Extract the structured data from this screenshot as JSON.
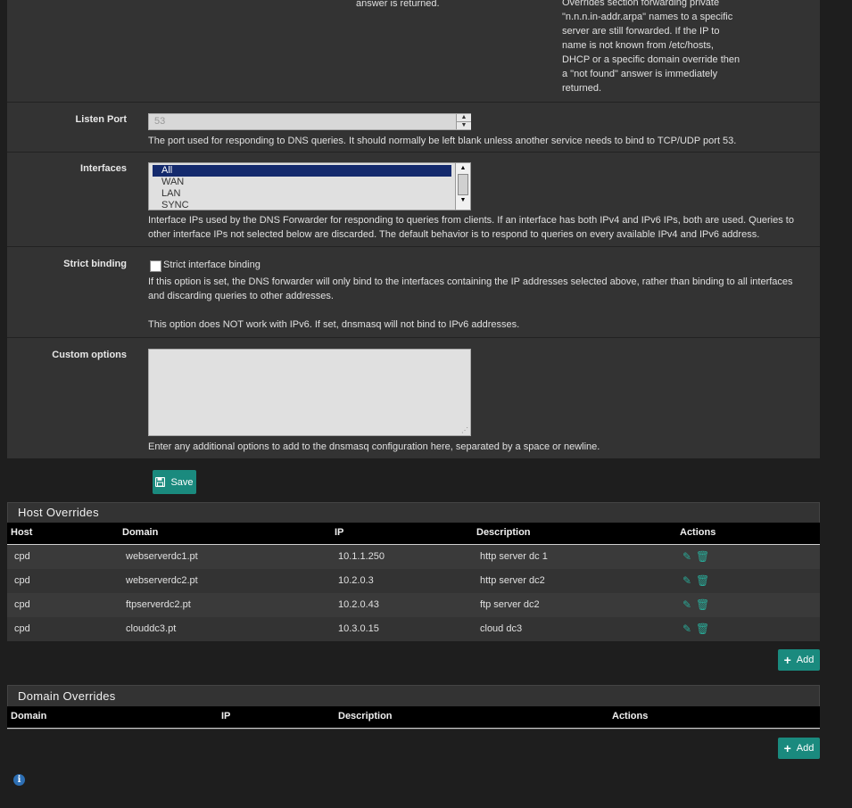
{
  "top_section": {
    "left_text": "answer is returned.",
    "right_text_lines": [
      "Overrides section forwarding private",
      "\"n.n.n.in-addr.arpa\" names to a specific",
      "server are still forwarded. If the IP to",
      "name is not known from /etc/hosts,",
      "DHCP or a specific domain override then",
      "a \"not found\" answer is immediately",
      "returned."
    ]
  },
  "listen_port": {
    "label": "Listen Port",
    "placeholder": "53",
    "help": "The port used for responding to DNS queries. It should normally be left blank unless another service needs to bind to TCP/UDP port 53."
  },
  "interfaces": {
    "label": "Interfaces",
    "options": [
      "All",
      "WAN",
      "LAN",
      "SYNC"
    ],
    "selected": "All",
    "help_line1": "Interface IPs used by the DNS Forwarder for responding to queries from clients. If an interface has both IPv4 and IPv6 IPs, both are used. Queries to",
    "help_line2": "other interface IPs not selected below are discarded. The default behavior is to respond to queries on every available IPv4 and IPv6 address."
  },
  "strict_binding": {
    "label": "Strict binding",
    "checkbox_label": "Strict interface binding",
    "checked": false,
    "help_line1": "If this option is set, the DNS forwarder will only bind to the interfaces containing the IP addresses selected above, rather than binding to all interfaces",
    "help_line2": "and discarding queries to other addresses.",
    "help_line3": "This option does NOT work with IPv6. If set, dnsmasq will not bind to IPv6 addresses."
  },
  "custom_options": {
    "label": "Custom options",
    "value": "",
    "help": "Enter any additional options to add to the dnsmasq configuration here, separated by a space or newline."
  },
  "save_button": {
    "label": "Save"
  },
  "host_overrides": {
    "title": "Host Overrides",
    "columns": [
      "Host",
      "Domain",
      "IP",
      "Description",
      "Actions"
    ],
    "rows": [
      {
        "host": "cpd",
        "domain": "webserverdc1.pt",
        "ip": "10.1.1.250",
        "description": "http server dc 1"
      },
      {
        "host": "cpd",
        "domain": "webserverdc2.pt",
        "ip": "10.2.0.3",
        "description": "http server dc2"
      },
      {
        "host": "cpd",
        "domain": "ftpserverdc2.pt",
        "ip": "10.2.0.43",
        "description": "ftp server dc2"
      },
      {
        "host": "cpd",
        "domain": "clouddc3.pt",
        "ip": "10.3.0.15",
        "description": "cloud dc3"
      }
    ],
    "add_label": "Add"
  },
  "domain_overrides": {
    "title": "Domain Overrides",
    "columns": [
      "Domain",
      "IP",
      "Description",
      "Actions"
    ],
    "add_label": "Add"
  },
  "colors": {
    "accent": "#1a8a7e",
    "panel": "#333333",
    "background": "#1e1e1e",
    "selected_option": "#142a6d"
  }
}
